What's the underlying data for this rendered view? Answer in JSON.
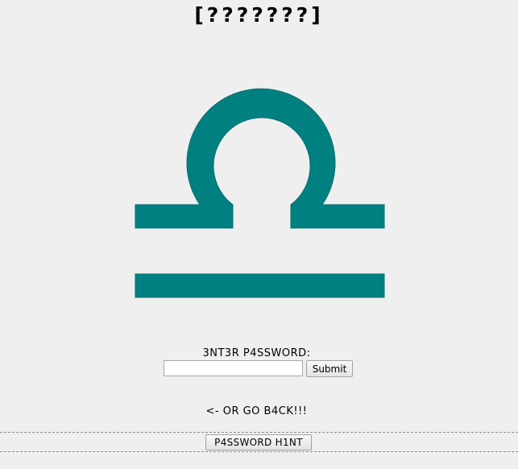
{
  "header": {
    "title": "[???????]"
  },
  "symbol": {
    "icon": "libra-icon",
    "color": "#008080"
  },
  "form": {
    "label": "3NT3R P4SSWORD:",
    "password_value": "",
    "submit_label": "Submit"
  },
  "navigation": {
    "back_text": "<- OR GO B4CK!!!"
  },
  "hint": {
    "button_label": "P4SSWORD H1NT"
  }
}
